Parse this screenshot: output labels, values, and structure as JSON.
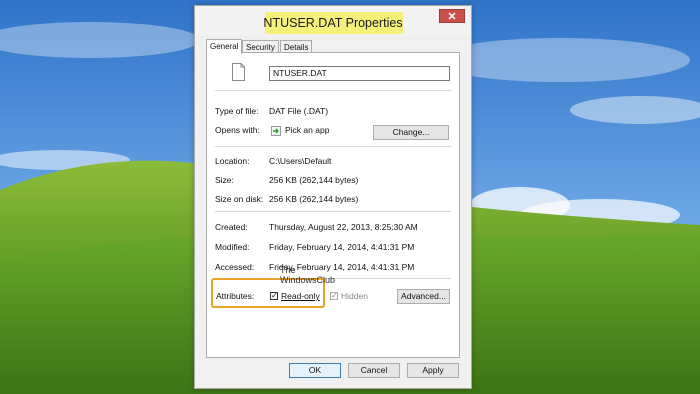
{
  "dialog": {
    "title": "NTUSER.DAT Properties",
    "close_label": "✕",
    "tabs": [
      {
        "label": "General",
        "active": true
      },
      {
        "label": "Security",
        "active": false
      },
      {
        "label": "Details",
        "active": false
      }
    ],
    "file_name": "NTUSER.DAT",
    "type_label": "Type of file:",
    "type_value": "DAT File (.DAT)",
    "opens_label": "Opens with:",
    "opens_value": "Pick an app",
    "change_button": "Change...",
    "location_label": "Location:",
    "location_value": "C:\\Users\\Default",
    "size_label": "Size:",
    "size_value": "256 KB (262,144 bytes)",
    "size_disk_label": "Size on disk:",
    "size_disk_value": "256 KB (262,144 bytes)",
    "created_label": "Created:",
    "created_value": "Thursday, August 22, 2013, 8:25:30 AM",
    "modified_label": "Modified:",
    "modified_value": "Friday, February 14, 2014, 4:41:31 PM",
    "accessed_label": "Accessed:",
    "accessed_value": "Friday, February 14, 2014, 4:41:31 PM",
    "attributes_label": "Attributes:",
    "readonly_label": "Read-only",
    "readonly_checked": true,
    "hidden_label": "Hidden",
    "hidden_checked": true,
    "advanced_button": "Advanced...",
    "ok_button": "OK",
    "cancel_button": "Cancel",
    "apply_button": "Apply"
  },
  "watermark": {
    "line1": "The",
    "line2": "WindowsClub"
  },
  "colors": {
    "title_highlight": "#f5f07a",
    "attributes_highlight": "#e7a425",
    "close_button": "#c7504b"
  }
}
